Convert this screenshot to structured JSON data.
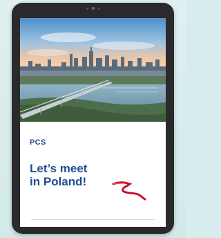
{
  "brand": {
    "name": "PCS"
  },
  "headline": {
    "line1": "Let’s meet",
    "line2": "in Poland!"
  },
  "colors": {
    "brand_blue": "#1f4d8f",
    "ribbon_red": "#c8102e",
    "tablet_frame": "#2a2a2c",
    "page_bg": "#d7ecec"
  },
  "hero_image": {
    "subject": "city skyline over river with bridge at sunset"
  }
}
